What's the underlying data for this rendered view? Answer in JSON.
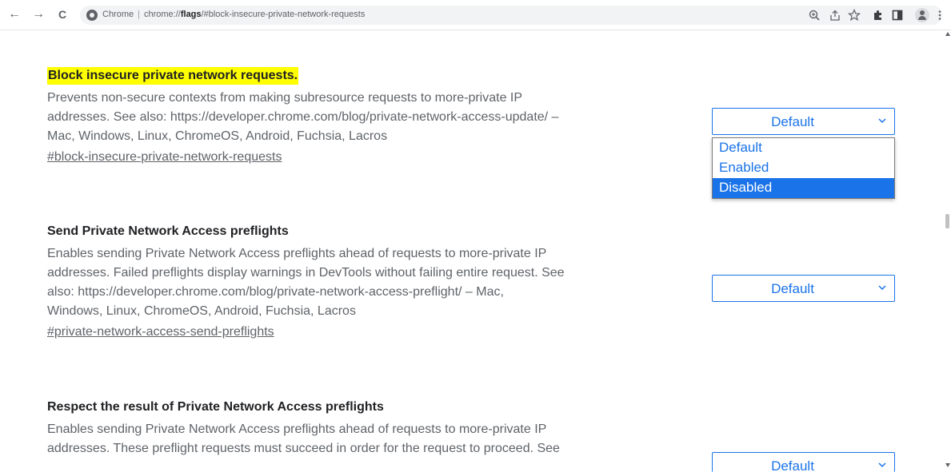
{
  "toolbar": {
    "back_icon": "←",
    "forward_icon": "→",
    "reload_icon": "C",
    "site_label": "Chrome",
    "separator": "|",
    "url_prefix": "chrome://",
    "url_host": "flags",
    "url_path": "/#block-insecure-private-network-requests",
    "icons": [
      "zoom-icon",
      "share-icon",
      "bookmark-star-icon",
      "extensions-icon",
      "side-panel-icon",
      "profile-icon",
      "menu-icon"
    ]
  },
  "experiments": [
    {
      "title": "Block insecure private network requests.",
      "desc_lines": [
        "Prevents non-secure contexts from making subresource requests to more-private IP",
        "addresses. See also: https://developer.chrome.com/blog/private-network-access-update/ –",
        "Mac, Windows, Linux, ChromeOS, Android, Fuchsia, Lacros"
      ],
      "link": "#block-insecure-private-network-requests",
      "select_value": "Default",
      "options": [
        "Default",
        "Enabled",
        "Disabled"
      ],
      "highlighted_option": "Disabled"
    },
    {
      "title": "Send Private Network Access preflights",
      "desc_lines": [
        "Enables sending Private Network Access preflights ahead of requests to more-private IP",
        "addresses. Failed preflights display warnings in DevTools without failing entire request. See",
        "also: https://developer.chrome.com/blog/private-network-access-preflight/ – Mac,",
        "Windows, Linux, ChromeOS, Android, Fuchsia, Lacros"
      ],
      "link": "#private-network-access-send-preflights",
      "select_value": "Default"
    },
    {
      "title": "Respect the result of Private Network Access preflights",
      "desc_lines": [
        "Enables sending Private Network Access preflights ahead of requests to more-private IP",
        "addresses. These preflight requests must succeed in order for the request to proceed. See"
      ],
      "select_value": "Default"
    }
  ],
  "colors": {
    "accent": "#1a73e8",
    "highlight": "#ffff00",
    "text_primary": "#202124",
    "text_secondary": "#5f6368"
  }
}
